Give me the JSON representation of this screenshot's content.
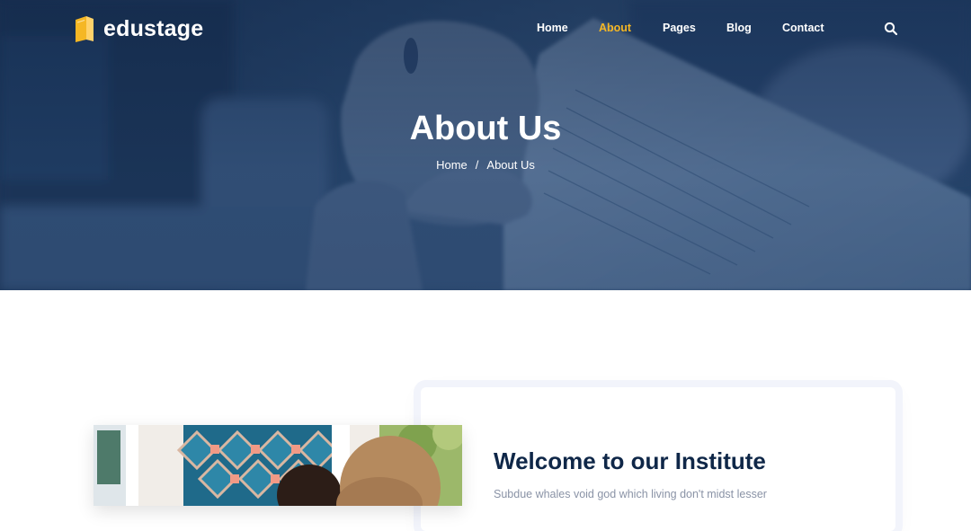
{
  "brand": {
    "name": "edustage",
    "logo_icon": "book-icon",
    "accent": "#f5b724"
  },
  "nav": {
    "items": [
      {
        "label": "Home",
        "active": false
      },
      {
        "label": "About",
        "active": true
      },
      {
        "label": "Pages",
        "active": false
      },
      {
        "label": "Blog",
        "active": false
      },
      {
        "label": "Contact",
        "active": false
      }
    ],
    "search_icon": "search-icon"
  },
  "hero": {
    "title": "About Us",
    "breadcrumb": {
      "home": "Home",
      "separator": "/",
      "current": "About Us"
    }
  },
  "about": {
    "heading": "Welcome to our Institute",
    "text": "Subdue whales void god which living don't midst lesser"
  },
  "colors": {
    "heading": "#0f2748",
    "body_text": "#8a93a6",
    "hero_base": "#1d3557"
  }
}
